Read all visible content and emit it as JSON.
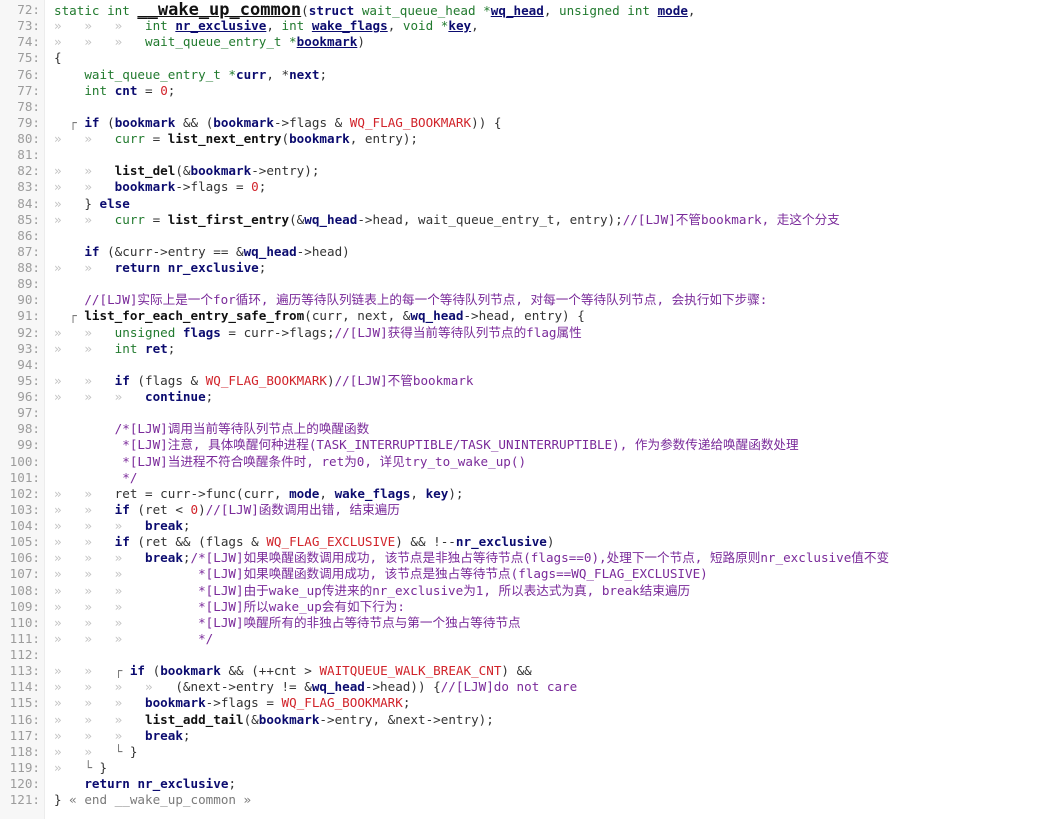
{
  "editor": {
    "lines": [
      {
        "n": "72:",
        "t": [
          [
            "ty",
            "static int "
          ],
          [
            "fnu big",
            "__wake_up_common"
          ],
          [
            "pl",
            "("
          ],
          [
            "kw",
            "struct"
          ],
          [
            "ty",
            " wait_queue_head *"
          ],
          [
            "idu",
            "wq_head"
          ],
          [
            "pl",
            ", "
          ],
          [
            "ty",
            "unsigned int "
          ],
          [
            "idu",
            "mode"
          ],
          [
            "pl",
            ","
          ]
        ]
      },
      {
        "n": "73:",
        "t": [
          [
            "ws",
            "»   »   »   "
          ],
          [
            "ty",
            "int "
          ],
          [
            "idu",
            "nr_exclusive"
          ],
          [
            "pl",
            ", "
          ],
          [
            "ty",
            "int "
          ],
          [
            "idu",
            "wake_flags"
          ],
          [
            "pl",
            ", "
          ],
          [
            "ty",
            "void *"
          ],
          [
            "idu",
            "key"
          ],
          [
            "pl",
            ","
          ]
        ]
      },
      {
        "n": "74:",
        "t": [
          [
            "ws",
            "»   »   »   "
          ],
          [
            "ty",
            "wait_queue_entry_t *"
          ],
          [
            "idu",
            "bookmark"
          ],
          [
            "pl",
            ")"
          ]
        ]
      },
      {
        "n": "75:",
        "t": [
          [
            "pl",
            "{"
          ]
        ]
      },
      {
        "n": "76:",
        "t": [
          [
            "ws",
            "    "
          ],
          [
            "ty",
            "wait_queue_entry_t *"
          ],
          [
            "id",
            "curr"
          ],
          [
            "pl",
            ", *"
          ],
          [
            "id",
            "next"
          ],
          [
            "pl",
            ";"
          ]
        ]
      },
      {
        "n": "77:",
        "t": [
          [
            "ws",
            "    "
          ],
          [
            "ty",
            "int "
          ],
          [
            "id",
            "cnt"
          ],
          [
            "pl",
            " = "
          ],
          [
            "num",
            "0"
          ],
          [
            "pl",
            ";"
          ]
        ]
      },
      {
        "n": "78:",
        "t": []
      },
      {
        "n": "79:",
        "t": [
          [
            "fold",
            "  ┌ "
          ],
          [
            "kw",
            "if"
          ],
          [
            "pl",
            " ("
          ],
          [
            "id",
            "bookmark"
          ],
          [
            "pl",
            " && ("
          ],
          [
            "id",
            "bookmark"
          ],
          [
            "pl",
            "->flags & "
          ],
          [
            "mac",
            "WQ_FLAG_BOOKMARK"
          ],
          [
            "pl",
            ")) {"
          ]
        ]
      },
      {
        "n": "80:",
        "t": [
          [
            "ws",
            "»   »   "
          ],
          [
            "ty",
            "curr"
          ],
          [
            "pl",
            " = "
          ],
          [
            "fn",
            "list_next_entry"
          ],
          [
            "pl",
            "("
          ],
          [
            "id",
            "bookmark"
          ],
          [
            "pl",
            ", entry);"
          ]
        ]
      },
      {
        "n": "81:",
        "t": []
      },
      {
        "n": "82:",
        "t": [
          [
            "ws",
            "»   »   "
          ],
          [
            "fn",
            "list_del"
          ],
          [
            "pl",
            "(&"
          ],
          [
            "id",
            "bookmark"
          ],
          [
            "pl",
            "->entry);"
          ]
        ]
      },
      {
        "n": "83:",
        "t": [
          [
            "ws",
            "»   »   "
          ],
          [
            "id",
            "bookmark"
          ],
          [
            "pl",
            "->flags = "
          ],
          [
            "num",
            "0"
          ],
          [
            "pl",
            ";"
          ]
        ]
      },
      {
        "n": "84:",
        "t": [
          [
            "ws",
            "»   "
          ],
          [
            "pl",
            "} "
          ],
          [
            "kw",
            "else"
          ]
        ]
      },
      {
        "n": "85:",
        "t": [
          [
            "ws",
            "»   »   "
          ],
          [
            "ty",
            "curr"
          ],
          [
            "pl",
            " = "
          ],
          [
            "fn",
            "list_first_entry"
          ],
          [
            "pl",
            "(&"
          ],
          [
            "id",
            "wq_head"
          ],
          [
            "pl",
            "->head, wait_queue_entry_t, entry);"
          ],
          [
            "cm",
            "//[LJW]不管bookmark, 走这个分支"
          ]
        ]
      },
      {
        "n": "86:",
        "t": []
      },
      {
        "n": "87:",
        "t": [
          [
            "ws",
            "    "
          ],
          [
            "kw",
            "if"
          ],
          [
            "pl",
            " (&curr->entry == &"
          ],
          [
            "id",
            "wq_head"
          ],
          [
            "pl",
            "->head)"
          ]
        ]
      },
      {
        "n": "88:",
        "t": [
          [
            "ws",
            "»   »   "
          ],
          [
            "kw",
            "return"
          ],
          [
            "pl",
            " "
          ],
          [
            "id",
            "nr_exclusive"
          ],
          [
            "pl",
            ";"
          ]
        ]
      },
      {
        "n": "89:",
        "t": []
      },
      {
        "n": "90:",
        "t": [
          [
            "ws",
            "    "
          ],
          [
            "cm",
            "//[LJW]实际上是一个for循环, 遍历等待队列链表上的每一个等待队列节点, 对每一个等待队列节点, 会执行如下步骤:"
          ]
        ]
      },
      {
        "n": "91:",
        "t": [
          [
            "fold",
            "  ┌ "
          ],
          [
            "fn",
            "list_for_each_entry_safe_from"
          ],
          [
            "pl",
            "(curr, next, &"
          ],
          [
            "id",
            "wq_head"
          ],
          [
            "pl",
            "->head, entry) {"
          ]
        ]
      },
      {
        "n": "92:",
        "t": [
          [
            "ws",
            "»   »   "
          ],
          [
            "ty",
            "unsigned "
          ],
          [
            "id",
            "flags"
          ],
          [
            "pl",
            " = curr->flags;"
          ],
          [
            "cm",
            "//[LJW]获得当前等待队列节点的flag属性"
          ]
        ]
      },
      {
        "n": "93:",
        "t": [
          [
            "ws",
            "»   »   "
          ],
          [
            "ty",
            "int "
          ],
          [
            "id",
            "ret"
          ],
          [
            "pl",
            ";"
          ]
        ]
      },
      {
        "n": "94:",
        "t": []
      },
      {
        "n": "95:",
        "t": [
          [
            "ws",
            "»   »   "
          ],
          [
            "kw",
            "if"
          ],
          [
            "pl",
            " (flags & "
          ],
          [
            "mac",
            "WQ_FLAG_BOOKMARK"
          ],
          [
            "pl",
            ")"
          ],
          [
            "cm",
            "//[LJW]不管bookmark"
          ]
        ]
      },
      {
        "n": "96:",
        "t": [
          [
            "ws",
            "»   »   »   "
          ],
          [
            "kw",
            "continue"
          ],
          [
            "pl",
            ";"
          ]
        ]
      },
      {
        "n": "97:",
        "t": []
      },
      {
        "n": "98:",
        "t": [
          [
            "ws",
            "        "
          ],
          [
            "cm",
            "/*[LJW]调用当前等待队列节点上的唤醒函数"
          ]
        ]
      },
      {
        "n": "99:",
        "t": [
          [
            "ws",
            "        "
          ],
          [
            "cm",
            " *[LJW]注意, 具体唤醒何种进程(TASK_INTERRUPTIBLE/TASK_UNINTERRUPTIBLE), 作为参数传递给唤醒函数处理"
          ]
        ]
      },
      {
        "n": "100:",
        "t": [
          [
            "ws",
            "        "
          ],
          [
            "cm",
            " *[LJW]当进程不符合唤醒条件时, ret为0, 详见try_to_wake_up()"
          ]
        ]
      },
      {
        "n": "101:",
        "t": [
          [
            "ws",
            "        "
          ],
          [
            "cm",
            " */"
          ]
        ]
      },
      {
        "n": "102:",
        "t": [
          [
            "ws",
            "»   »   "
          ],
          [
            "pl",
            "ret = curr->func(curr, "
          ],
          [
            "id",
            "mode"
          ],
          [
            "pl",
            ", "
          ],
          [
            "id",
            "wake_flags"
          ],
          [
            "pl",
            ", "
          ],
          [
            "id",
            "key"
          ],
          [
            "pl",
            ");"
          ]
        ]
      },
      {
        "n": "103:",
        "t": [
          [
            "ws",
            "»   »   "
          ],
          [
            "kw",
            "if"
          ],
          [
            "pl",
            " (ret < "
          ],
          [
            "num",
            "0"
          ],
          [
            "pl",
            ")"
          ],
          [
            "cm",
            "//[LJW]函数调用出错, 结束遍历"
          ]
        ]
      },
      {
        "n": "104:",
        "t": [
          [
            "ws",
            "»   »   »   "
          ],
          [
            "kw",
            "break"
          ],
          [
            "pl",
            ";"
          ]
        ]
      },
      {
        "n": "105:",
        "t": [
          [
            "ws",
            "»   »   "
          ],
          [
            "kw",
            "if"
          ],
          [
            "pl",
            " (ret && (flags & "
          ],
          [
            "mac",
            "WQ_FLAG_EXCLUSIVE"
          ],
          [
            "pl",
            ") && !--"
          ],
          [
            "id",
            "nr_exclusive"
          ],
          [
            "pl",
            ")"
          ]
        ]
      },
      {
        "n": "106:",
        "t": [
          [
            "ws",
            "»   »   »   "
          ],
          [
            "kw",
            "break"
          ],
          [
            "pl",
            ";"
          ],
          [
            "cm",
            "/*[LJW]如果唤醒函数调用成功, 该节点是非独占等待节点(flags==0),处理下一个节点, 短路原则nr_exclusive值不变"
          ]
        ]
      },
      {
        "n": "107:",
        "t": [
          [
            "ws",
            "»   »   »   "
          ],
          [
            "cm",
            "       *[LJW]如果唤醒函数调用成功, 该节点是独占等待节点(flags==WQ_FLAG_EXCLUSIVE)"
          ]
        ]
      },
      {
        "n": "108:",
        "t": [
          [
            "ws",
            "»   »   »   "
          ],
          [
            "cm",
            "       *[LJW]由于wake_up传进来的nr_exclusive为1, 所以表达式为真, break结束遍历"
          ]
        ]
      },
      {
        "n": "109:",
        "t": [
          [
            "ws",
            "»   »   »   "
          ],
          [
            "cm",
            "       *[LJW]所以wake_up会有如下行为:"
          ]
        ]
      },
      {
        "n": "110:",
        "t": [
          [
            "ws",
            "»   »   »   "
          ],
          [
            "cm",
            "       *[LJW]唤醒所有的非独占等待节点与第一个独占等待节点"
          ]
        ]
      },
      {
        "n": "111:",
        "t": [
          [
            "ws",
            "»   »   »   "
          ],
          [
            "cm",
            "       */"
          ]
        ]
      },
      {
        "n": "112:",
        "t": []
      },
      {
        "n": "113:",
        "t": [
          [
            "ws",
            "»   »   "
          ],
          [
            "fold",
            "┌ "
          ],
          [
            "kw",
            "if"
          ],
          [
            "pl",
            " ("
          ],
          [
            "id",
            "bookmark"
          ],
          [
            "pl",
            " && (++cnt > "
          ],
          [
            "mac",
            "WAITQUEUE_WALK_BREAK_CNT"
          ],
          [
            "pl",
            ") &&"
          ]
        ]
      },
      {
        "n": "114:",
        "t": [
          [
            "ws",
            "»   »   »   »   "
          ],
          [
            "pl",
            "(&next->entry != &"
          ],
          [
            "id",
            "wq_head"
          ],
          [
            "pl",
            "->head)) {"
          ],
          [
            "cm",
            "//[LJW]do not care"
          ]
        ]
      },
      {
        "n": "115:",
        "t": [
          [
            "ws",
            "»   »   »   "
          ],
          [
            "id",
            "bookmark"
          ],
          [
            "pl",
            "->flags = "
          ],
          [
            "mac",
            "WQ_FLAG_BOOKMARK"
          ],
          [
            "pl",
            ";"
          ]
        ]
      },
      {
        "n": "116:",
        "t": [
          [
            "ws",
            "»   »   »   "
          ],
          [
            "fn",
            "list_add_tail"
          ],
          [
            "pl",
            "(&"
          ],
          [
            "id",
            "bookmark"
          ],
          [
            "pl",
            "->entry, &next->entry);"
          ]
        ]
      },
      {
        "n": "117:",
        "t": [
          [
            "ws",
            "»   »   »   "
          ],
          [
            "kw",
            "break"
          ],
          [
            "pl",
            ";"
          ]
        ]
      },
      {
        "n": "118:",
        "t": [
          [
            "ws",
            "»   »   "
          ],
          [
            "fold",
            "└ "
          ],
          [
            "pl",
            "}"
          ]
        ]
      },
      {
        "n": "119:",
        "t": [
          [
            "ws",
            "»   "
          ],
          [
            "fold",
            "└ "
          ],
          [
            "pl",
            "}"
          ]
        ]
      },
      {
        "n": "120:",
        "t": [
          [
            "ws",
            "    "
          ],
          [
            "kw",
            "return"
          ],
          [
            "pl",
            " "
          ],
          [
            "id",
            "nr_exclusive"
          ],
          [
            "pl",
            ";"
          ]
        ]
      },
      {
        "n": "121:",
        "t": [
          [
            "pl",
            "} "
          ],
          [
            "fold",
            "« end __wake_up_common »"
          ]
        ]
      }
    ]
  }
}
